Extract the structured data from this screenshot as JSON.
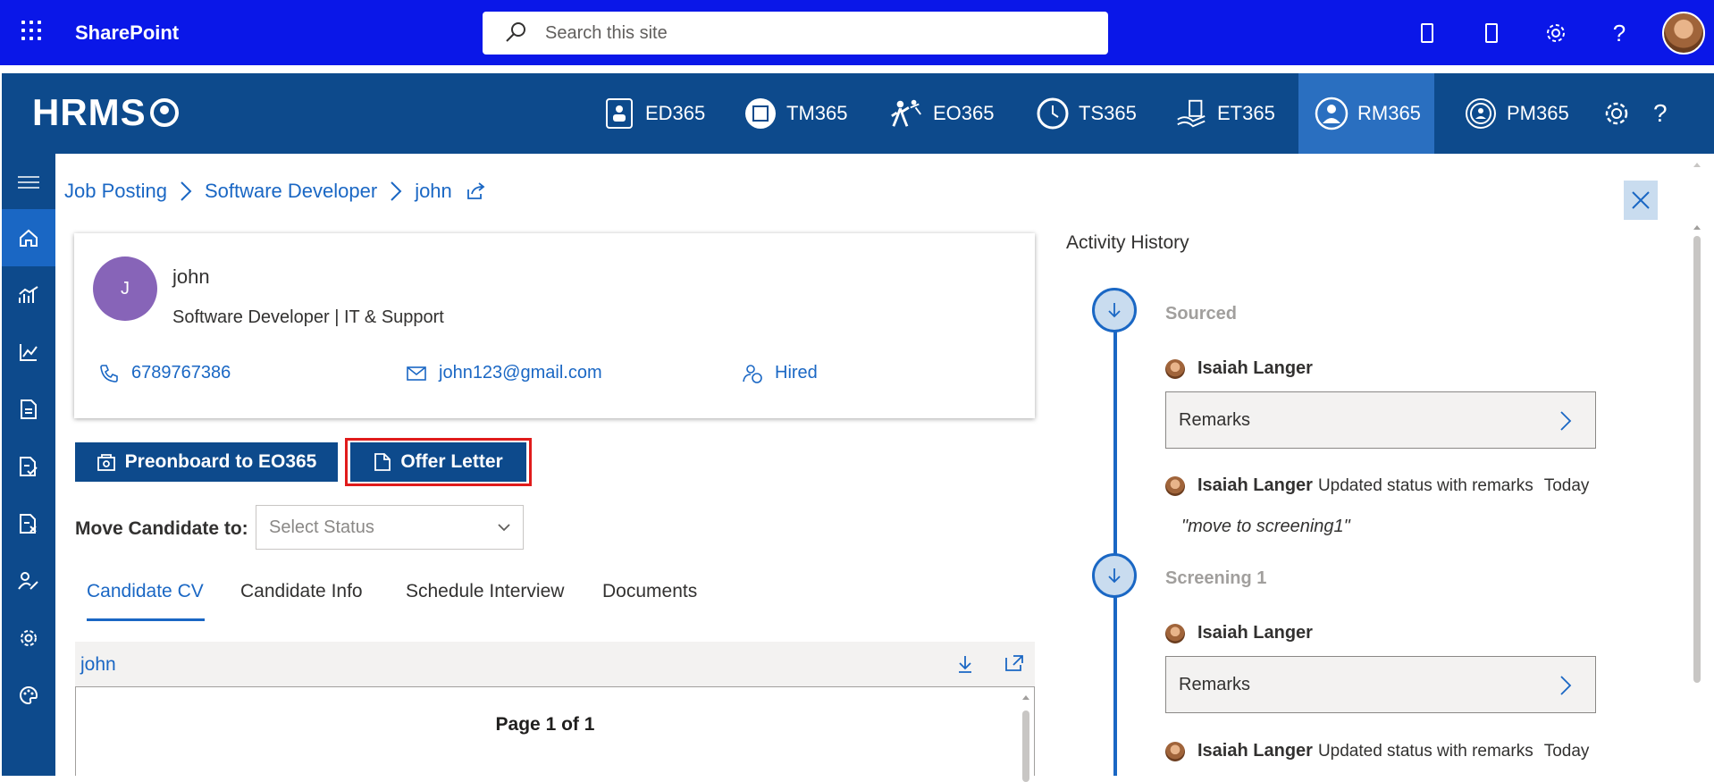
{
  "sharepoint": {
    "title": "SharePoint",
    "search_placeholder": "Search this site"
  },
  "hrms": {
    "logo": "HRMS",
    "modules": [
      {
        "label": "ED365",
        "icon": "employee-directory-icon"
      },
      {
        "label": "TM365",
        "icon": "task-manager-icon"
      },
      {
        "label": "EO365",
        "icon": "onboarding-icon"
      },
      {
        "label": "TS365",
        "icon": "timesheet-icon"
      },
      {
        "label": "ET365",
        "icon": "expense-icon"
      },
      {
        "label": "RM365",
        "icon": "recruitment-icon",
        "active": true
      },
      {
        "label": "PM365",
        "icon": "performance-icon"
      }
    ]
  },
  "breadcrumb": {
    "items": [
      "Job Posting",
      "Software Developer",
      "john"
    ]
  },
  "candidate": {
    "initial": "J",
    "name": "john",
    "role": "Software Developer | IT & Support",
    "phone": "6789767386",
    "email": "john123@gmail.com",
    "status": "Hired"
  },
  "actions": {
    "preonboard": "Preonboard to EO365",
    "offer_letter": "Offer Letter",
    "move_label": "Move Candidate to:",
    "status_placeholder": "Select Status"
  },
  "tabs": [
    "Candidate CV",
    "Candidate Info",
    "Schedule Interview",
    "Documents"
  ],
  "cv": {
    "title": "john",
    "page": "Page 1 of 1"
  },
  "activity": {
    "title": "Activity History",
    "stages": [
      {
        "name": "Sourced"
      },
      {
        "name": "Screening 1"
      }
    ],
    "user": "Isaiah Langer",
    "remarks_label": "Remarks",
    "updated_text": "Updated status with remarks",
    "today": "Today",
    "quote": "\"move to screening1\""
  },
  "colors": {
    "sharepoint_bar": "#0a17e8",
    "hrms_bar": "#0d4a8c",
    "accent": "#1a67c4",
    "highlight": "#e01b1b"
  }
}
